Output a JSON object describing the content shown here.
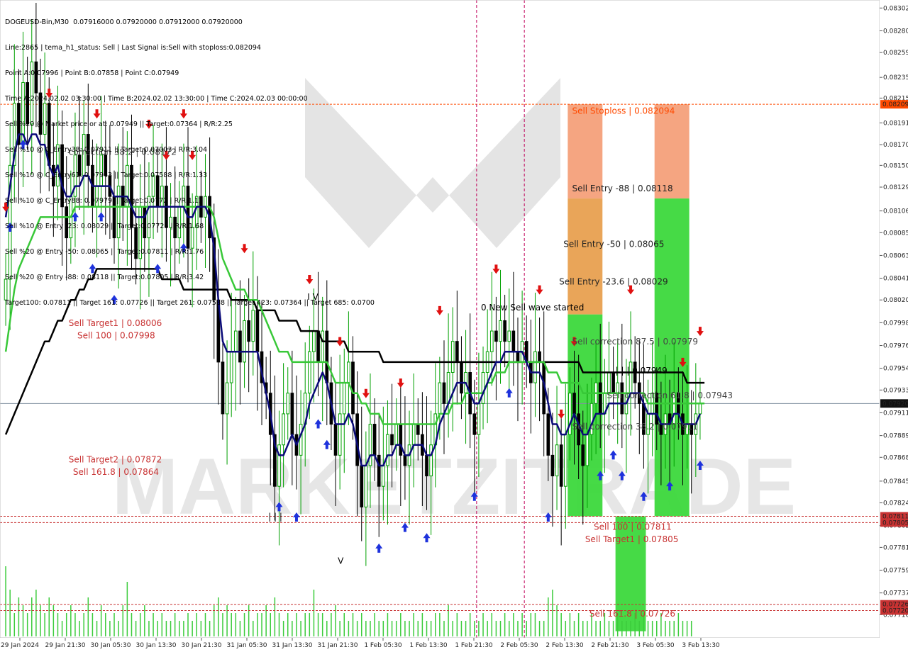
{
  "info_lines": [
    "DOGEUSD-Bin,M30  0.07916000 0.07920000 0.07912000 0.07920000",
    "Line:2865 | tema_h1_status: Sell | Last Signal is:Sell with stoploss:0.082094",
    "Point A:0.07996 | Point B:0.07858 | Point C:0.07949",
    "Time A:2024.02.02 03:30:00 | Time B:2024.02.02 13:30:00 | Time C:2024.02.03 00:00:00",
    "Sell %20 @ Market price or at: 0.07949 || Target:0.07364 | R/R:2.25",
    "Sell %10 @ C_Entry38: 0.07911 || Target:0.07003 | R/R:3.04",
    "Sell %10 @ C_Entry61: 0.07943 || Target:0.07588 | R/R:1.33",
    "Sell %10 @ C_Entry88: 0.07979 || Target:0.0772 | R/R:1.12",
    "Sell %10 @ Entry -23: 0.08029 || Target:0.07726 | R/R:1.68",
    "Sell %20 @ Entry -50: 0.08065 || Target:0.07811 | R/R:1.76",
    "Sell %20 @ Entry -88: 0.08118 || Target:0.07805 | R/R:3.42",
    "Target100: 0.07811 || Target 161: 0.07726 || Target 261: 0.07588 || Target 423: 0.07364 || Target 685: 0.0700"
  ],
  "watermark": "MARKETZITRADE",
  "colors": {
    "bull": "#00a000",
    "bear": "#000000",
    "tema": "#0a0a78",
    "ma_green": "#38c838",
    "ma_black": "#000000",
    "target_red": "#c83232",
    "stop_orange": "#ff4a00",
    "entry_orange": "#e8a050",
    "box_green": "#3cd83c",
    "volume": "#3ccc3c",
    "magenta": "#c0005a",
    "buy_arrow": "#1e32dc",
    "sell_arrow": "#e01010"
  },
  "chart_data": {
    "type": "candlestick",
    "symbol": "DOGEUSD-Bin,M30",
    "ylim": [
      0.07695,
      0.08307
    ],
    "y_ticks": [
      "0.08302",
      "0.08280",
      "0.08259",
      "0.08235",
      "0.08215",
      "0.08191",
      "0.08170",
      "0.08150",
      "0.08129",
      "0.08106",
      "0.08085",
      "0.08063",
      "0.08041",
      "0.08020",
      "0.07998",
      "0.07976",
      "0.07954",
      "0.07933",
      "0.07911",
      "0.07889",
      "0.07868",
      "0.07845",
      "0.07824",
      "0.07802",
      "0.07781",
      "0.07759",
      "0.07737",
      "0.07716"
    ],
    "x_ticks": [
      "29 Jan 2024",
      "29 Jan 21:30",
      "30 Jan 05:30",
      "30 Jan 13:30",
      "30 Jan 21:30",
      "31 Jan 05:30",
      "31 Jan 13:30",
      "31 Jan 21:30",
      "1 Feb 05:30",
      "1 Feb 13:30",
      "1 Feb 21:30",
      "2 Feb 05:30",
      "2 Feb 13:30",
      "2 Feb 21:30",
      "3 Feb 05:30",
      "3 Feb 13:30"
    ],
    "current_price": "0.07920",
    "price_tags": [
      {
        "value": "0.08209",
        "price": 0.08209,
        "color": "#ff4a00"
      },
      {
        "value": "0.07811",
        "price": 0.07811,
        "color": "#c83232"
      },
      {
        "value": "0.07805",
        "price": 0.07805,
        "color": "#c83232"
      },
      {
        "value": "0.07726",
        "price": 0.07726,
        "color": "#c83232"
      },
      {
        "value": "0.07720",
        "price": 0.0772,
        "color": "#c83232"
      }
    ],
    "hlines": [
      {
        "price": 0.08209,
        "color": "#ff4a00"
      },
      {
        "price": 0.07811,
        "color": "#c83232"
      },
      {
        "price": 0.07805,
        "color": "#c83232"
      },
      {
        "price": 0.07726,
        "color": "#c83232"
      },
      {
        "price": 0.0772,
        "color": "#c83232"
      },
      {
        "price": 0.0792,
        "color": "#8090a0"
      }
    ],
    "closes": [
      0.0804,
      0.0815,
      0.0821,
      0.0817,
      0.0823,
      0.0819,
      0.0825,
      0.0822,
      0.0818,
      0.0821,
      0.0815,
      0.0813,
      0.0817,
      0.0811,
      0.0808,
      0.0812,
      0.0816,
      0.0814,
      0.0818,
      0.0815,
      0.0811,
      0.0813,
      0.0816,
      0.0814,
      0.0812,
      0.0808,
      0.0813,
      0.0811,
      0.0815,
      0.0809,
      0.0806,
      0.0811,
      0.0808,
      0.0812,
      0.0814,
      0.0811,
      0.0813,
      0.0809,
      0.081,
      0.0808,
      0.0811,
      0.0813,
      0.0807,
      0.0809,
      0.0812,
      0.081,
      0.0812,
      0.0808,
      0.0802,
      0.0796,
      0.0791,
      0.0794,
      0.0797,
      0.0799,
      0.0796,
      0.08,
      0.0798,
      0.0801,
      0.0797,
      0.0794,
      0.0793,
      0.0789,
      0.0784,
      0.0788,
      0.0791,
      0.0793,
      0.0789,
      0.0787,
      0.079,
      0.0793,
      0.0797,
      0.0799,
      0.0796,
      0.0799,
      0.0794,
      0.079,
      0.0787,
      0.0791,
      0.0794,
      0.0796,
      0.0791,
      0.0786,
      0.0782,
      0.0786,
      0.079,
      0.0787,
      0.0784,
      0.0786,
      0.0789,
      0.0788,
      0.079,
      0.0787,
      0.0786,
      0.0788,
      0.079,
      0.0789,
      0.0787,
      0.0785,
      0.0788,
      0.0791,
      0.0794,
      0.0792,
      0.0795,
      0.0798,
      0.0796,
      0.0793,
      0.0795,
      0.0791,
      0.0789,
      0.0792,
      0.0795,
      0.0797,
      0.0799,
      0.0798,
      0.08,
      0.0798,
      0.0799,
      0.0797,
      0.0796,
      0.0798,
      0.0796,
      0.0794,
      0.0797,
      0.0796,
      0.0791,
      0.0787,
      0.0785,
      0.0788,
      0.0784,
      0.0789,
      0.0793,
      0.0791,
      0.0788,
      0.0786,
      0.0789,
      0.0792,
      0.0794,
      0.0791,
      0.0793,
      0.0795,
      0.0793,
      0.0794,
      0.0791,
      0.0793,
      0.0796,
      0.0794,
      0.0792,
      0.0789,
      0.0791,
      0.0793,
      0.079,
      0.0789,
      0.0791,
      0.079,
      0.0793,
      0.0791,
      0.0789,
      0.079,
      0.0789,
      0.0791,
      0.0792
    ],
    "tema": [
      0.081,
      0.0813,
      0.0816,
      0.0818,
      0.0818,
      0.0817,
      0.0818,
      0.0818,
      0.0817,
      0.0817,
      0.0815,
      0.0814,
      0.0815,
      0.0813,
      0.0812,
      0.0812,
      0.0813,
      0.0813,
      0.0814,
      0.0814,
      0.0813,
      0.0813,
      0.0813,
      0.0813,
      0.0813,
      0.0812,
      0.0812,
      0.0812,
      0.0812,
      0.0811,
      0.081,
      0.081,
      0.081,
      0.0811,
      0.0811,
      0.0811,
      0.0811,
      0.0811,
      0.0811,
      0.0811,
      0.0811,
      0.0811,
      0.081,
      0.081,
      0.0811,
      0.0811,
      0.0811,
      0.081,
      0.0807,
      0.0802,
      0.0798,
      0.0797,
      0.0797,
      0.0797,
      0.0797,
      0.0797,
      0.0797,
      0.0797,
      0.0797,
      0.0795,
      0.0793,
      0.0791,
      0.0788,
      0.0787,
      0.0787,
      0.0788,
      0.0789,
      0.0788,
      0.0789,
      0.079,
      0.0792,
      0.0793,
      0.0794,
      0.0795,
      0.0794,
      0.0792,
      0.079,
      0.079,
      0.079,
      0.0791,
      0.079,
      0.0788,
      0.0786,
      0.0786,
      0.0787,
      0.0787,
      0.0786,
      0.0786,
      0.0787,
      0.0787,
      0.0788,
      0.0788,
      0.0787,
      0.0787,
      0.0788,
      0.0788,
      0.0788,
      0.0787,
      0.0787,
      0.0788,
      0.079,
      0.0791,
      0.0792,
      0.0793,
      0.0794,
      0.0794,
      0.0794,
      0.0793,
      0.0792,
      0.0792,
      0.0793,
      0.0794,
      0.0795,
      0.0796,
      0.0796,
      0.0797,
      0.0797,
      0.0797,
      0.0797,
      0.0797,
      0.0796,
      0.0795,
      0.0795,
      0.0795,
      0.0794,
      0.0792,
      0.079,
      0.079,
      0.0789,
      0.0789,
      0.079,
      0.0791,
      0.079,
      0.0789,
      0.0789,
      0.079,
      0.0791,
      0.0791,
      0.0791,
      0.0792,
      0.0792,
      0.0792,
      0.0792,
      0.0792,
      0.0793,
      0.0793,
      0.0793,
      0.0792,
      0.0791,
      0.0791,
      0.0791,
      0.079,
      0.079,
      0.079,
      0.0791,
      0.0791,
      0.079,
      0.079,
      0.079,
      0.079,
      0.0791
    ],
    "ma_green": [
      0.0797,
      0.08,
      0.0803,
      0.0805,
      0.0806,
      0.0807,
      0.0808,
      0.0809,
      0.081,
      0.081,
      0.081,
      0.081,
      0.081,
      0.081,
      0.081,
      0.081,
      0.0811,
      0.0811,
      0.0811,
      0.0811,
      0.0811,
      0.0811,
      0.0811,
      0.0811,
      0.0811,
      0.0811,
      0.0811,
      0.0811,
      0.0811,
      0.0811,
      0.0811,
      0.0811,
      0.0811,
      0.0811,
      0.0811,
      0.0811,
      0.0811,
      0.0811,
      0.0811,
      0.0811,
      0.0811,
      0.0811,
      0.0811,
      0.0811,
      0.0811,
      0.0811,
      0.0811,
      0.0811,
      0.081,
      0.0808,
      0.0806,
      0.0805,
      0.0804,
      0.0803,
      0.0803,
      0.0803,
      0.0802,
      0.0802,
      0.0802,
      0.0801,
      0.08,
      0.0799,
      0.0798,
      0.0797,
      0.0797,
      0.0797,
      0.0796,
      0.0796,
      0.0796,
      0.0796,
      0.0796,
      0.0796,
      0.0796,
      0.0796,
      0.0796,
      0.0795,
      0.0794,
      0.0794,
      0.0794,
      0.0794,
      0.0793,
      0.0793,
      0.0792,
      0.0792,
      0.0791,
      0.0791,
      0.0791,
      0.079,
      0.079,
      0.079,
      0.079,
      0.079,
      0.079,
      0.079,
      0.079,
      0.079,
      0.079,
      0.079,
      0.079,
      0.079,
      0.0791,
      0.0791,
      0.0791,
      0.0792,
      0.0792,
      0.0792,
      0.0793,
      0.0793,
      0.0793,
      0.0793,
      0.0793,
      0.0794,
      0.0794,
      0.0795,
      0.0795,
      0.0795,
      0.0796,
      0.0796,
      0.0796,
      0.0796,
      0.0796,
      0.0796,
      0.0796,
      0.0796,
      0.0796,
      0.0795,
      0.0795,
      0.0795,
      0.0794,
      0.0794,
      0.0794,
      0.0794,
      0.0794,
      0.0793,
      0.0793,
      0.0793,
      0.0793,
      0.0793,
      0.0793,
      0.0793,
      0.0793,
      0.0793,
      0.0793,
      0.0793,
      0.0793,
      0.0793,
      0.0793,
      0.0793,
      0.0792,
      0.0792,
      0.0792,
      0.0792,
      0.0792,
      0.0792,
      0.0792,
      0.0792,
      0.0792,
      0.0792,
      0.0792,
      0.0792,
      0.0792,
      0.0792
    ],
    "ma_black": [
      0.0789,
      0.079,
      0.0791,
      0.0792,
      0.0793,
      0.0794,
      0.0795,
      0.0796,
      0.0797,
      0.0798,
      0.0798,
      0.0799,
      0.08,
      0.08,
      0.0801,
      0.0802,
      0.0802,
      0.0803,
      0.0803,
      0.0804,
      0.0804,
      0.0805,
      0.0805,
      0.0805,
      0.0805,
      0.0805,
      0.0805,
      0.0805,
      0.0805,
      0.0805,
      0.0805,
      0.0805,
      0.0805,
      0.0805,
      0.0805,
      0.0805,
      0.0804,
      0.0804,
      0.0804,
      0.0804,
      0.0804,
      0.0803,
      0.0803,
      0.0803,
      0.0803,
      0.0803,
      0.0803,
      0.0803,
      0.0803,
      0.0803,
      0.0803,
      0.0803,
      0.0802,
      0.0802,
      0.0802,
      0.0802,
      0.0802,
      0.0802,
      0.0801,
      0.0801,
      0.0801,
      0.0801,
      0.0801,
      0.08,
      0.08,
      0.08,
      0.08,
      0.08,
      0.0799,
      0.0799,
      0.0799,
      0.0799,
      0.0799,
      0.0798,
      0.0798,
      0.0798,
      0.0798,
      0.0798,
      0.0798,
      0.0797,
      0.0797,
      0.0797,
      0.0797,
      0.0797,
      0.0797,
      0.0797,
      0.0797,
      0.0796,
      0.0796,
      0.0796,
      0.0796,
      0.0796,
      0.0796,
      0.0796,
      0.0796,
      0.0796,
      0.0796,
      0.0796,
      0.0796,
      0.0796,
      0.0796,
      0.0796,
      0.0796,
      0.0796,
      0.0796,
      0.0796,
      0.0796,
      0.0796,
      0.0796,
      0.0796,
      0.0796,
      0.0796,
      0.0796,
      0.0796,
      0.0796,
      0.0796,
      0.0796,
      0.0796,
      0.0796,
      0.0796,
      0.0796,
      0.0796,
      0.0796,
      0.0796,
      0.0796,
      0.0796,
      0.0796,
      0.0796,
      0.0796,
      0.0796,
      0.0796,
      0.0796,
      0.0796,
      0.0795,
      0.0795,
      0.0795,
      0.0795,
      0.0795,
      0.0795,
      0.0795,
      0.0795,
      0.0795,
      0.0795,
      0.0795,
      0.0795,
      0.0795,
      0.0795,
      0.0795,
      0.0795,
      0.0795,
      0.0795,
      0.0795,
      0.0795,
      0.0795,
      0.0795,
      0.0795,
      0.0795,
      0.0794,
      0.0794,
      0.0794,
      0.0794,
      0.0794
    ],
    "volume": [
      0.9,
      0.6,
      0.3,
      0.5,
      0.4,
      0.3,
      0.5,
      0.6,
      0.4,
      0.3,
      0.5,
      0.4,
      0.3,
      0.2,
      0.3,
      0.4,
      0.3,
      0.2,
      0.3,
      0.5,
      0.3,
      0.2,
      0.4,
      0.3,
      0.2,
      0.3,
      0.2,
      0.4,
      0.7,
      0.3,
      0.2,
      0.3,
      0.4,
      0.2,
      0.3,
      0.2,
      0.3,
      0.2,
      0.2,
      0.3,
      0.2,
      0.2,
      0.3,
      0.2,
      0.3,
      0.2,
      0.3,
      0.2,
      0.4,
      0.5,
      0.3,
      0.4,
      0.3,
      0.3,
      0.2,
      0.3,
      0.4,
      0.2,
      0.3,
      0.3,
      0.4,
      0.3,
      0.5,
      0.3,
      0.2,
      0.3,
      0.2,
      0.3,
      0.2,
      0.3,
      0.3,
      0.6,
      0.3,
      0.3,
      0.2,
      0.3,
      0.4,
      0.2,
      0.3,
      0.2,
      0.3,
      0.2,
      0.3,
      0.2,
      0.2,
      0.3,
      0.2,
      0.2,
      0.3,
      0.2,
      0.2,
      0.3,
      0.2,
      0.2,
      0.3,
      0.2,
      0.3,
      0.2,
      0.2,
      0.3,
      0.3,
      0.2,
      0.4,
      0.2,
      0.3,
      0.2,
      0.2,
      0.3,
      0.2,
      0.2,
      0.3,
      0.2,
      0.3,
      0.2,
      0.2,
      0.3,
      0.2,
      0.3,
      0.2,
      0.3,
      0.2,
      0.3,
      0.3,
      0.2,
      0.2,
      0.5,
      0.6,
      0.4,
      0.3,
      0.2,
      0.3,
      0.2,
      0.3,
      0.2,
      0.2,
      0.3,
      0.2,
      0.2,
      0.3,
      0.2,
      0.2,
      0.3,
      0.2,
      0.2,
      0.2,
      0.3,
      0.2,
      0.3,
      0.2,
      0.2,
      0.2,
      0.3,
      0.2,
      0.2,
      0.2,
      0.3,
      0.2,
      0.2,
      0.2
    ],
    "zones": [
      {
        "name": "sell-stoploss-zone",
        "left_bar": 130,
        "right_bar": 138,
        "top": 0.08209,
        "bottom": 0.08118,
        "color": "#f4a07a"
      },
      {
        "name": "sell-entry-zone-1",
        "left_bar": 130,
        "right_bar": 138,
        "top": 0.08118,
        "bottom": 0.08006,
        "color": "#e8a050"
      },
      {
        "name": "sell-target-zone-1",
        "left_bar": 130,
        "right_bar": 138,
        "top": 0.08006,
        "bottom": 0.07811,
        "color": "#3cd83c"
      },
      {
        "name": "sell-entry-zone-2",
        "left_bar": 150,
        "right_bar": 158,
        "top": 0.08209,
        "bottom": 0.08118,
        "color": "#f4a07a"
      },
      {
        "name": "sell-target-zone-2",
        "left_bar": 150,
        "right_bar": 158,
        "top": 0.08118,
        "bottom": 0.07811,
        "color": "#3cd83c"
      },
      {
        "name": "sell-target-zone-3",
        "left_bar": 141,
        "right_bar": 148,
        "top": 0.07811,
        "bottom": 0.077,
        "color": "#3cd83c"
      }
    ],
    "vlines_bar": [
      109,
      120
    ],
    "annotations": [
      {
        "text": "Sell Stoploss | 0.082094",
        "price": 0.082,
        "bar": 131,
        "color": "#ff4a00"
      },
      {
        "text": "Sell Entry -88 | 0.08118",
        "price": 0.08125,
        "bar": 131,
        "color": "#222222"
      },
      {
        "text": "Sell Entry -50 | 0.08065",
        "price": 0.08071,
        "bar": 129,
        "color": "#222222"
      },
      {
        "text": "Sell Entry -23.6 | 0.08029",
        "price": 0.08035,
        "bar": 128,
        "color": "#222222"
      },
      {
        "text": "0 New Sell wave started",
        "price": 0.0801,
        "bar": 110,
        "color": "#000000"
      },
      {
        "text": "Sell correction 87.5 | 0.07979",
        "price": 0.07977,
        "bar": 131,
        "color": "#444444"
      },
      {
        "text": "| | | 0.07949",
        "price": 0.07949,
        "bar": 141,
        "color": "#000000"
      },
      {
        "text": "Sell correction 61.8 | 0.07943",
        "price": 0.07925,
        "bar": 139,
        "color": "#444444"
      },
      {
        "text": "Sell correction 38.2 | 0.07911",
        "price": 0.07895,
        "bar": 131,
        "color": "#444444"
      },
      {
        "text": "Sell Target1 | 0.08006",
        "price": 0.07995,
        "bar": 15,
        "color": "#c83232"
      },
      {
        "text": "Sell 100 | 0.07998",
        "price": 0.07983,
        "bar": 17,
        "color": "#c83232"
      },
      {
        "text": "Sell Target2 | 0.07872",
        "price": 0.07863,
        "bar": 15,
        "color": "#c83232"
      },
      {
        "text": "Sell 161.8 | 0.07864",
        "price": 0.07851,
        "bar": 16,
        "color": "#c83232"
      },
      {
        "text": "Sell 100 | 0.07811",
        "price": 0.07798,
        "bar": 136,
        "color": "#c83232"
      },
      {
        "text": "Sell Target1 | 0.07805",
        "price": 0.07786,
        "bar": 134,
        "color": "#c83232"
      },
      {
        "text": "Sell 161.8 | 0.07726",
        "price": 0.07714,
        "bar": 135,
        "color": "#c83232"
      },
      {
        "text": "correction 38.2 | 0.08172",
        "price": 0.0816,
        "bar": 15,
        "color": "#444444"
      },
      {
        "text": "| | |",
        "price": 0.07808,
        "bar": 61,
        "color": "#000000"
      },
      {
        "text": "V",
        "price": 0.07765,
        "bar": 77,
        "color": "#000000"
      },
      {
        "text": "I V",
        "price": 0.0802,
        "bar": 70,
        "color": "#000000"
      }
    ],
    "buy_arrows": [
      1,
      4,
      16,
      20,
      22,
      25,
      35,
      41,
      63,
      67,
      72,
      74,
      86,
      92,
      97,
      108,
      116,
      125,
      137,
      140,
      142,
      147,
      153,
      160,
      163,
      170,
      172
    ],
    "sell_arrows": [
      0,
      10,
      21,
      33,
      37,
      41,
      43,
      55,
      70,
      77,
      83,
      91,
      100,
      113,
      123,
      128,
      131,
      144,
      156,
      160,
      165,
      168,
      171
    ]
  }
}
